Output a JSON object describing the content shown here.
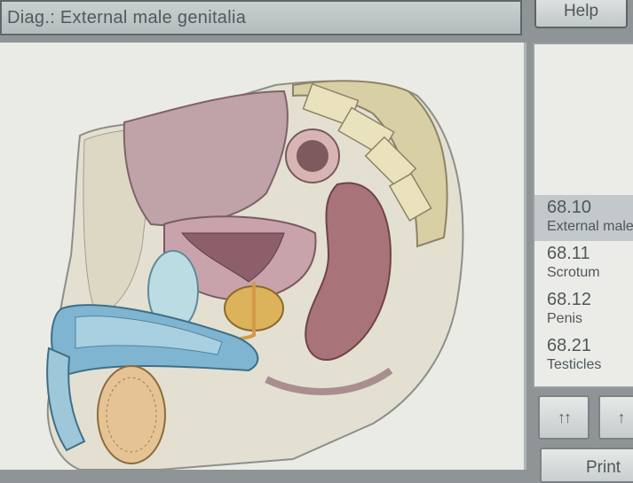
{
  "header": {
    "title": "Diag.: External male genitalia",
    "help_label": "Help"
  },
  "codes": [
    {
      "code": "68.10",
      "label": "External male genitalia",
      "selected": true
    },
    {
      "code": "68.11",
      "label": "Scrotum",
      "selected": false
    },
    {
      "code": "68.12",
      "label": "Penis",
      "selected": false
    },
    {
      "code": "68.21",
      "label": "Testicles",
      "selected": false
    }
  ],
  "nav": {
    "up_label": "↑↑",
    "down_label": "↑",
    "print_label": "Print"
  },
  "colors": {
    "panel_bg": "#ebebe6",
    "selected_bg": "#c3c9ca",
    "text": "#505759"
  }
}
